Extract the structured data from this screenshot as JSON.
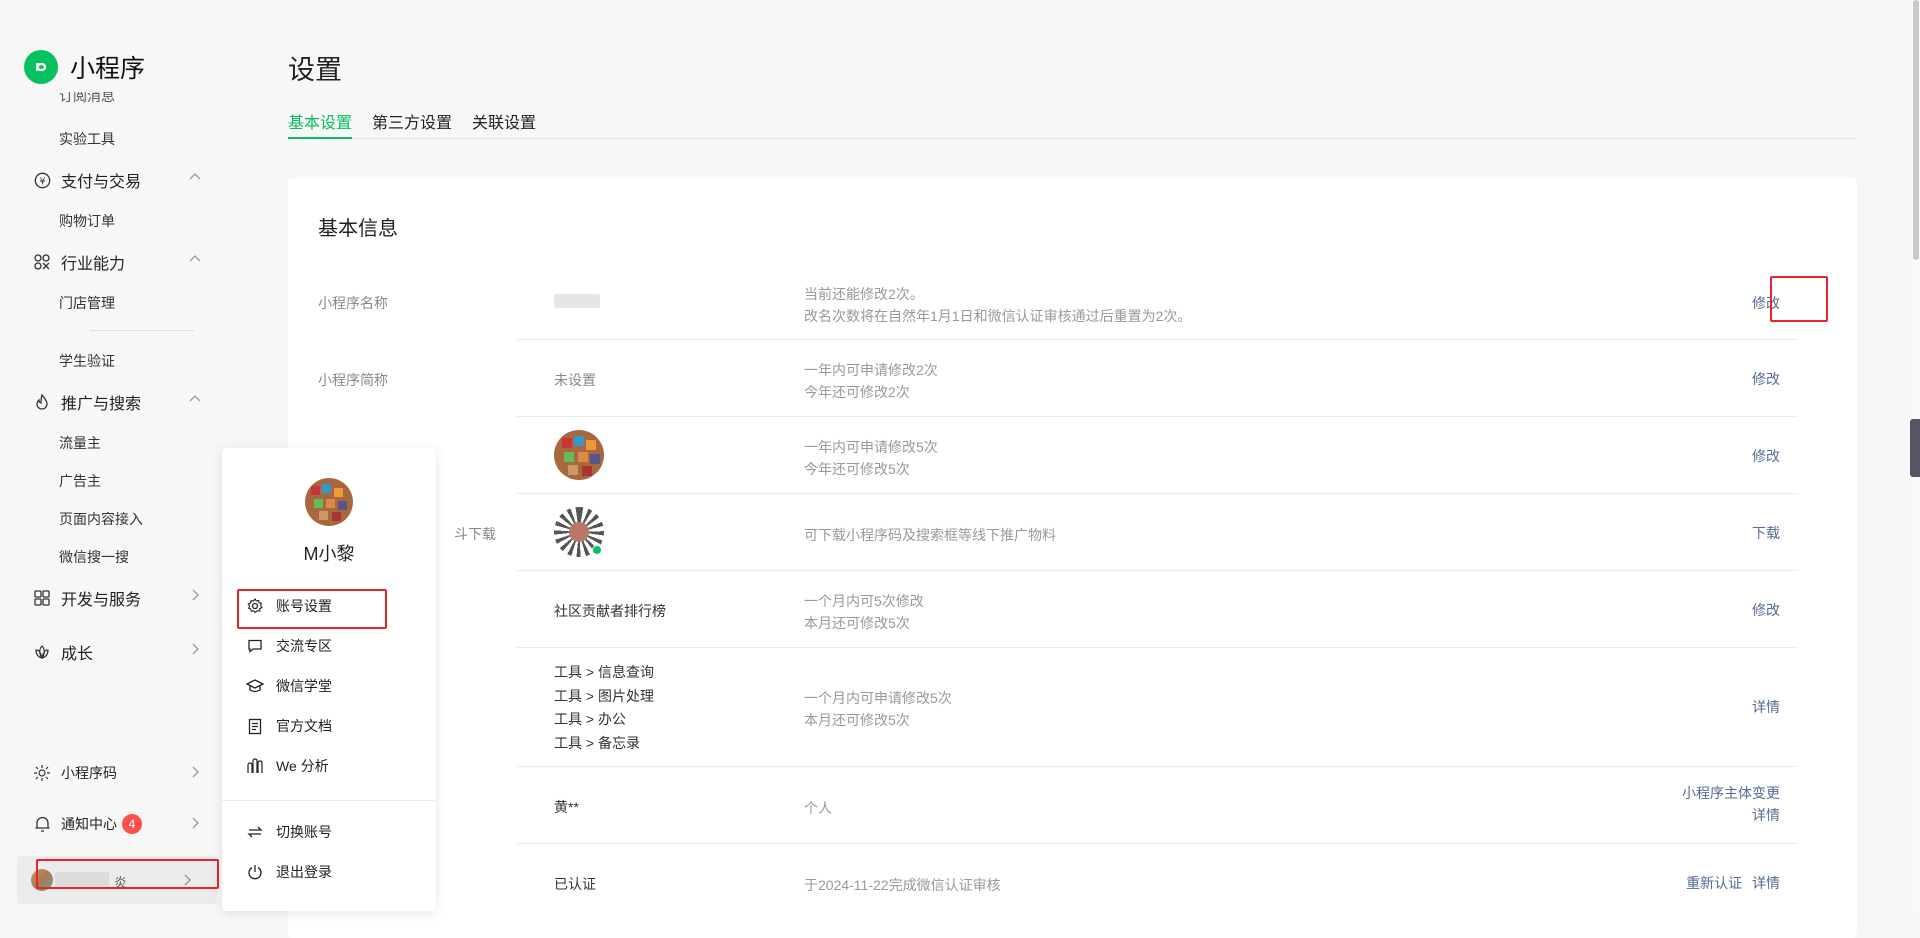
{
  "app": {
    "title": "小程序"
  },
  "sidebar": {
    "partial_item": "订阅消息",
    "lab_tools": "实验工具",
    "groups": [
      {
        "label": "支付与交易",
        "children": [
          "购物订单"
        ]
      },
      {
        "label": "行业能力",
        "children": [
          "门店管理",
          "学生验证"
        ]
      },
      {
        "label": "推广与搜索",
        "children": [
          "流量主",
          "广告主",
          "页面内容接入",
          "微信搜一搜"
        ]
      },
      {
        "label": "开发与服务"
      },
      {
        "label": "成长"
      }
    ],
    "bottom": {
      "qrcode_label": "小程序码",
      "notify_label": "通知中心",
      "notify_count": "4",
      "user_name_partial": "炎"
    }
  },
  "page": {
    "title": "设置",
    "tabs": [
      "基本设置",
      "第三方设置",
      "关联设置"
    ]
  },
  "card": {
    "title": "基本信息",
    "rows": [
      {
        "label": "小程序名称",
        "desc1": "当前还能修改2次。",
        "desc2": "改名次数将在自然年1月1日和微信认证审核通过后重置为2次。",
        "action": "修改"
      },
      {
        "label": "小程序简称",
        "value": "未设置",
        "desc1": "一年内可申请修改2次",
        "desc2": "今年还可修改2次",
        "action": "修改"
      },
      {
        "desc1": "一年内可申请修改5次",
        "desc2": "今年还可修改5次",
        "action": "修改"
      },
      {
        "label_partial": "斗下载",
        "desc1": "可下载小程序码及搜索框等线下推广物料",
        "action": "下载"
      },
      {
        "value": "社区贡献者排行榜",
        "desc1": "一个月内可5次修改",
        "desc2": "本月还可修改5次",
        "action": "修改"
      },
      {
        "values": [
          "工具 > 信息查询",
          "工具 > 图片处理",
          "工具 > 办公",
          "工具 > 备忘录"
        ],
        "desc1": "一个月内可申请修改5次",
        "desc2": "本月还可修改5次",
        "action": "详情"
      },
      {
        "value": "黄**",
        "desc1": "个人",
        "action1": "小程序主体变更",
        "action2": "详情"
      },
      {
        "value": "已认证",
        "desc1": "于2024-11-22完成微信认证审核",
        "action1": "重新认证",
        "action2": "详情"
      }
    ]
  },
  "popup": {
    "user_name": "M小黎",
    "items": [
      "账号设置",
      "交流专区",
      "微信学堂",
      "官方文档",
      "We 分析"
    ],
    "items2": [
      "切换账号",
      "退出登录"
    ]
  },
  "colors": {
    "brand": "#07c160",
    "link": "#576b95",
    "highlight": "#e8232c",
    "badge": "#fa5151"
  }
}
